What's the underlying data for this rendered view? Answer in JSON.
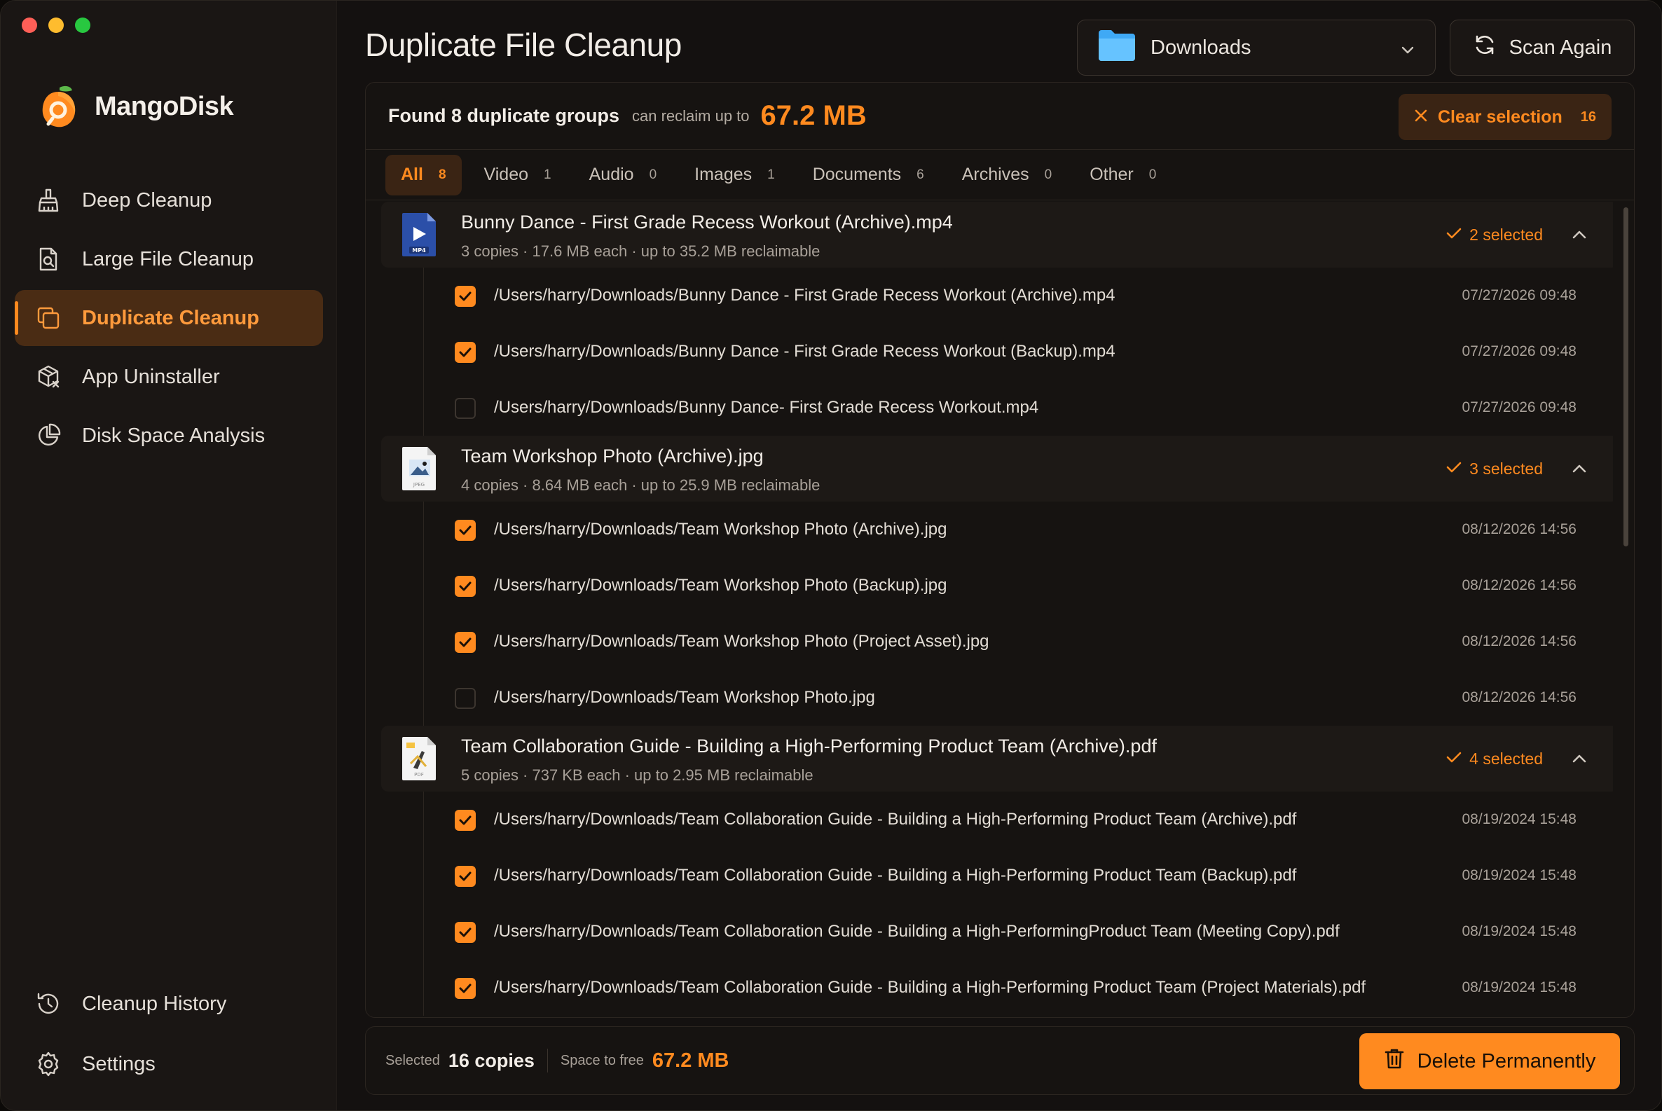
{
  "app": {
    "name": "MangoDisk",
    "accent": "#ff8a1f"
  },
  "sidebar": {
    "items": [
      {
        "label": "Deep Cleanup",
        "icon": "broom-icon"
      },
      {
        "label": "Large File Cleanup",
        "icon": "file-search-icon"
      },
      {
        "label": "Duplicate Cleanup",
        "icon": "copy-icon",
        "active": true
      },
      {
        "label": "App Uninstaller",
        "icon": "package-remove-icon"
      },
      {
        "label": "Disk Space Analysis",
        "icon": "pie-chart-icon"
      }
    ],
    "bottom": [
      {
        "label": "Cleanup History",
        "icon": "history-icon"
      },
      {
        "label": "Settings",
        "icon": "gear-icon"
      }
    ]
  },
  "header": {
    "title": "Duplicate File Cleanup",
    "folder": "Downloads",
    "scan_label": "Scan Again"
  },
  "summary": {
    "found": "Found 8 duplicate groups",
    "reclaim_label": "can reclaim up to",
    "reclaim_value": "67.2 MB",
    "clear_label": "Clear selection",
    "clear_count": "16"
  },
  "tabs": [
    {
      "label": "All",
      "count": "8",
      "active": true
    },
    {
      "label": "Video",
      "count": "1"
    },
    {
      "label": "Audio",
      "count": "0"
    },
    {
      "label": "Images",
      "count": "1"
    },
    {
      "label": "Documents",
      "count": "6"
    },
    {
      "label": "Archives",
      "count": "0"
    },
    {
      "label": "Other",
      "count": "0"
    }
  ],
  "groups": [
    {
      "title": "Bunny Dance - First Grade Recess Workout (Archive).mp4",
      "meta": "3 copies · 17.6 MB each · up to 35.2 MB reclaimable",
      "selected": "2 selected",
      "icon": "video-file-icon",
      "files": [
        {
          "path": "/Users/harry/Downloads/Bunny Dance - First Grade Recess Workout (Archive).mp4",
          "date": "07/27/2026 09:48",
          "checked": true
        },
        {
          "path": "/Users/harry/Downloads/Bunny Dance - First Grade Recess Workout (Backup).mp4",
          "date": "07/27/2026 09:48",
          "checked": true
        },
        {
          "path": "/Users/harry/Downloads/Bunny Dance- First Grade Recess Workout.mp4",
          "date": "07/27/2026 09:48",
          "checked": false
        }
      ]
    },
    {
      "title": "Team Workshop Photo (Archive).jpg",
      "meta": "4 copies · 8.64 MB each · up to 25.9 MB reclaimable",
      "selected": "3 selected",
      "icon": "image-file-icon",
      "files": [
        {
          "path": "/Users/harry/Downloads/Team Workshop Photo (Archive).jpg",
          "date": "08/12/2026 14:56",
          "checked": true
        },
        {
          "path": "/Users/harry/Downloads/Team Workshop Photo (Backup).jpg",
          "date": "08/12/2026 14:56",
          "checked": true
        },
        {
          "path": "/Users/harry/Downloads/Team Workshop Photo (Project Asset).jpg",
          "date": "08/12/2026 14:56",
          "checked": true
        },
        {
          "path": "/Users/harry/Downloads/Team Workshop Photo.jpg",
          "date": "08/12/2026 14:56",
          "checked": false
        }
      ]
    },
    {
      "title": "Team Collaboration Guide - Building a High-Performing Product Team (Archive).pdf",
      "meta": "5 copies · 737 KB each · up to 2.95 MB reclaimable",
      "selected": "4 selected",
      "icon": "pdf-file-icon",
      "files": [
        {
          "path": "/Users/harry/Downloads/Team Collaboration Guide - Building a High-Performing Product Team (Archive).pdf",
          "date": "08/19/2024 15:48",
          "checked": true
        },
        {
          "path": "/Users/harry/Downloads/Team Collaboration Guide - Building a High-Performing Product Team (Backup).pdf",
          "date": "08/19/2024 15:48",
          "checked": true
        },
        {
          "path": "/Users/harry/Downloads/Team Collaboration Guide - Building a High-PerformingProduct Team (Meeting Copy).pdf",
          "date": "08/19/2024 15:48",
          "checked": true
        },
        {
          "path": "/Users/harry/Downloads/Team Collaboration Guide - Building a High-Performing Product Team (Project Materials).pdf",
          "date": "08/19/2024 15:48",
          "checked": true
        }
      ]
    }
  ],
  "footer": {
    "selected_label": "Selected",
    "selected_value": "16 copies",
    "space_label": "Space to free",
    "space_value": "67.2 MB",
    "delete_label": "Delete Permanently"
  }
}
